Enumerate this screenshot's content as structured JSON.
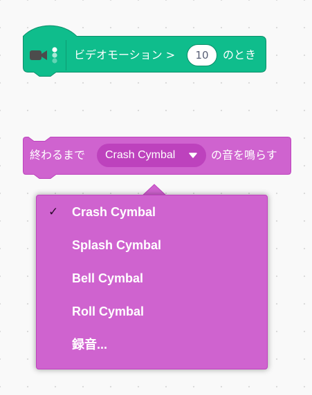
{
  "colors": {
    "video_sensing_block": "#0fbd8c",
    "video_sensing_border": "#0b8e69",
    "sound_block": "#cf63cf",
    "sound_border": "#bd42bd",
    "canvas_background": "#f9f9f9"
  },
  "hat_block": {
    "icon": "video-camera-icon",
    "text_before": "ビデオモーション >",
    "value": "10",
    "text_after": "のとき"
  },
  "sound_block": {
    "text_before": "終わるまで",
    "selected_sound": "Crash Cymbal",
    "text_after": "の音を鳴らす",
    "dropdown_icon": "triangle-down-icon"
  },
  "dropdown_menu": {
    "items": [
      {
        "label": "Crash Cymbal",
        "selected": true
      },
      {
        "label": "Splash Cymbal",
        "selected": false
      },
      {
        "label": "Bell Cymbal",
        "selected": false
      },
      {
        "label": "Roll Cymbal",
        "selected": false
      },
      {
        "label": "録音...",
        "selected": false
      }
    ],
    "check_glyph": "✓"
  }
}
